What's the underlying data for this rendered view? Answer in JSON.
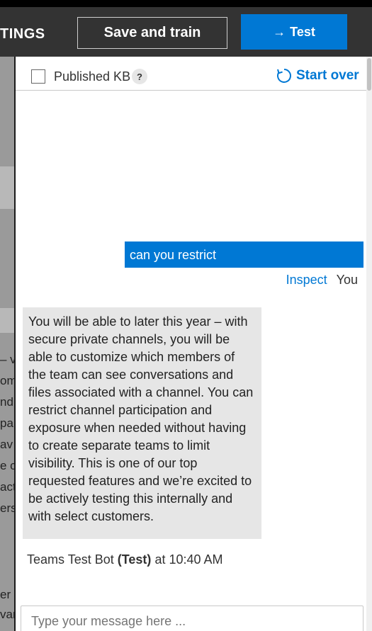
{
  "header": {
    "settings_tab": "TINGS",
    "save_button": "Save and train",
    "test_button": "Test",
    "test_icon": "arrow-right-icon"
  },
  "background_fragments": [
    "– v",
    "om",
    "nd",
    "pa",
    "av",
    "e c",
    "act",
    "ers",
    "er",
    "var"
  ],
  "panel": {
    "published_label": "Published KB",
    "help_glyph": "?",
    "start_over": "Start over",
    "start_over_icon": "refresh-icon"
  },
  "conversation": {
    "user_message": "can you restrict",
    "inspect_link": "Inspect",
    "user_name": "You",
    "bot_message": "You will be able to later this year – with secure private channels, you will be able to customize which members of the team can see conversations and files associated with a channel. You can restrict channel participation and exposure when needed without having to create separate teams to limit visibility. This is one of our top requested features and we’re excited to be actively testing this internally and with select customers.",
    "bot_name": "Teams Test Bot",
    "bot_tag": "(Test)",
    "bot_time": "at 10:40 AM"
  },
  "input": {
    "placeholder": "Type your message here ..."
  },
  "colors": {
    "accent": "#0078d4",
    "header_bg": "#333333",
    "bot_bubble": "#e6e6e6"
  }
}
